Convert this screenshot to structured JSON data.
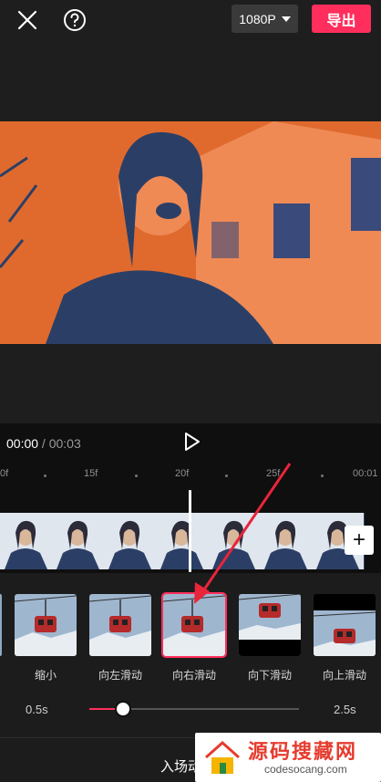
{
  "header": {
    "resolution_label": "1080P",
    "export_label": "导出"
  },
  "playback": {
    "current_time": "00:00",
    "separator": " / ",
    "total_time": "00:03"
  },
  "timeline": {
    "ticks": [
      "0f",
      "15f",
      "20f",
      "25f",
      "00:01"
    ]
  },
  "animations": {
    "items": [
      {
        "label": "缩小",
        "selected": false
      },
      {
        "label": "向左滑动",
        "selected": false
      },
      {
        "label": "向右滑动",
        "selected": true
      },
      {
        "label": "向下滑动",
        "selected": false
      },
      {
        "label": "向上滑动",
        "selected": false
      }
    ]
  },
  "duration": {
    "min_label": "0.5s",
    "max_label": "2.5s",
    "value_fraction": 0.16
  },
  "bottom": {
    "title": "入场动"
  },
  "watermark": {
    "name": "源码搜藏网",
    "url": "codesocang.com"
  },
  "colors": {
    "accent": "#ff2e5c",
    "video_tint": "#e06a2e",
    "track_blue": "#2b3f66"
  }
}
